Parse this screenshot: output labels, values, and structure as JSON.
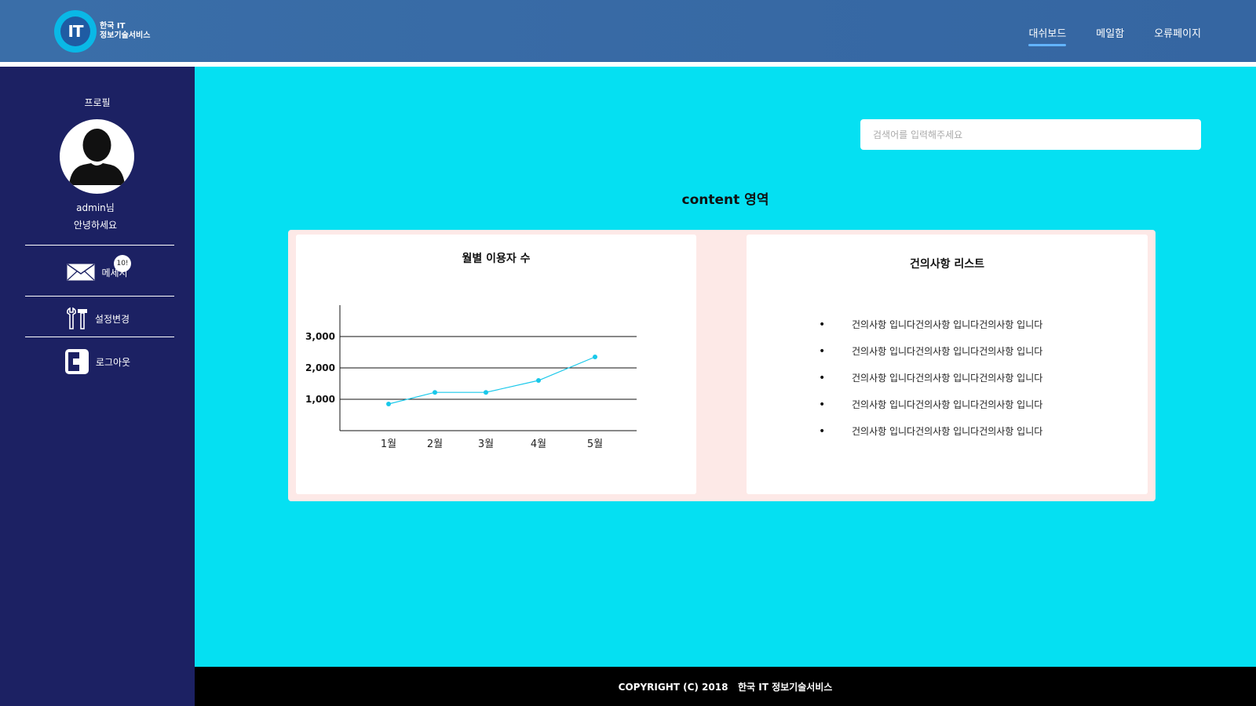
{
  "header": {
    "logo_mark": "IT",
    "logo_line1": "한국 IT",
    "logo_line2": "정보기술서비스",
    "nav": [
      "대쉬보드",
      "메일함",
      "오류페이지"
    ],
    "active_nav": "대쉬보드"
  },
  "sidebar": {
    "profile_title": "프로필",
    "user_name": "admin님",
    "greeting": "안녕하세요",
    "menu": [
      {
        "label": "메세지",
        "icon": "envelope-icon",
        "badge": "10!"
      },
      {
        "label": "설정변경",
        "icon": "tools-icon"
      },
      {
        "label": "로그아웃",
        "icon": "logout-icon"
      }
    ]
  },
  "main": {
    "search_placeholder": "검색어를 입력해주세요",
    "content_title": "content 영역",
    "chart_card_title": "월별 이용자 수",
    "list_card_title": "건의사항 리스트",
    "suggestions": [
      "건의사항 입니다건의사항 입니다건의사항 입니다",
      "건의사항 입니다건의사항 입니다건의사항 입니다",
      "건의사항 입니다건의사항 입니다건의사항 입니다",
      "건의사항 입니다건의사항 입니다건의사항 입니다",
      "건의사항 입니다건의사항 입니다건의사항 입니다"
    ]
  },
  "footer": {
    "text": "COPYRIGHT (C) 2018   한국 IT 정보기술서비스"
  },
  "colors": {
    "header": "#3566a2",
    "sidebar": "#1c2163",
    "main_bg": "#05e0f2",
    "panel_bg": "#fde9e7",
    "line": "#19c8ea"
  },
  "chart_data": {
    "type": "line",
    "title": "월별 이용자 수",
    "categories": [
      "1월",
      "2월",
      "3월",
      "4월",
      "5월"
    ],
    "values": [
      850,
      1220,
      1220,
      1600,
      2350
    ],
    "yticks": [
      "1,000",
      "2,000",
      "3,000"
    ],
    "ytick_values": [
      1000,
      2000,
      3000
    ],
    "ylim": [
      0,
      4000
    ],
    "grid": true
  }
}
